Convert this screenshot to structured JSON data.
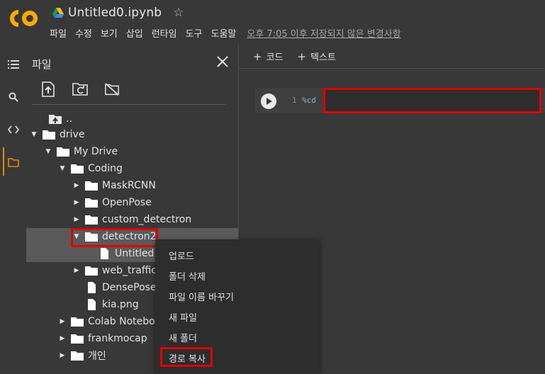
{
  "header": {
    "notebook_title": "Untitled0.ipynb",
    "menu": [
      "파일",
      "수정",
      "보기",
      "삽입",
      "런타임",
      "도구",
      "도움말"
    ],
    "save_status": "오후 7:05 이후 저장되지 않은 변경사항"
  },
  "file_panel": {
    "title": "파일",
    "tree": [
      {
        "label": "..",
        "icon": "folder-up-icon",
        "caret": ""
      },
      {
        "label": "drive",
        "icon": "folder-icon",
        "caret": "down"
      },
      {
        "label": "My Drive",
        "icon": "folder-icon",
        "caret": "down"
      },
      {
        "label": "Coding",
        "icon": "folder-icon",
        "caret": "down"
      },
      {
        "label": "MaskRCNN",
        "icon": "folder-icon",
        "caret": "right"
      },
      {
        "label": "OpenPose",
        "icon": "folder-icon",
        "caret": "right"
      },
      {
        "label": "custom_detectron",
        "icon": "folder-icon",
        "caret": "right"
      },
      {
        "label": "detectron2",
        "icon": "folder-icon",
        "caret": "down"
      },
      {
        "label": "Untitled",
        "icon": "file-icon",
        "caret": ""
      },
      {
        "label": "web_traffic",
        "icon": "folder-icon",
        "caret": "right"
      },
      {
        "label": "DensePose",
        "icon": "file-icon",
        "caret": ""
      },
      {
        "label": "kia.png",
        "icon": "file-icon",
        "caret": ""
      },
      {
        "label": "Colab Notebooks",
        "icon": "folder-icon",
        "caret": "right"
      },
      {
        "label": "frankmocap",
        "icon": "folder-icon",
        "caret": "right"
      },
      {
        "label": "개인",
        "icon": "folder-icon",
        "caret": "right"
      }
    ]
  },
  "main": {
    "toolbar": {
      "add_code": "코드",
      "add_text": "텍스트",
      "plus": "+"
    },
    "cell": {
      "line_number": "1",
      "code": "%cd"
    }
  },
  "context_menu": {
    "items": [
      "업로드",
      "폴더 삭제",
      "파일 이름 바꾸기",
      "새 파일",
      "새 폴더",
      "경로 복사"
    ]
  },
  "colors": {
    "accent": "#e58a00",
    "highlight": "#e00000"
  }
}
